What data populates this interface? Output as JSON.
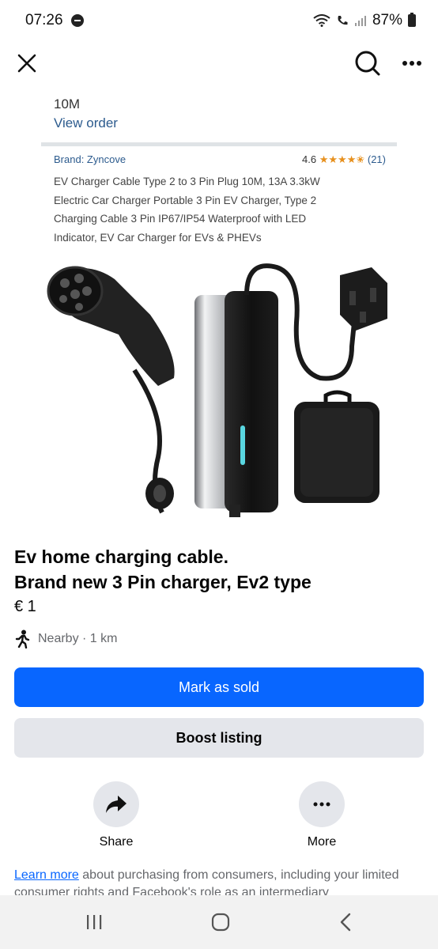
{
  "status_bar": {
    "time": "07:26",
    "battery": "87%"
  },
  "nav": {
    "close_icon": "close-icon",
    "search_icon": "search-icon",
    "more_icon": "more-icon"
  },
  "image": {
    "top_text": "10M",
    "view_order": "View order",
    "brand": "Brand: Zyncove",
    "rating": "4.6",
    "stars": "★★★★✬",
    "rating_count": "(21)",
    "description_lines": [
      "EV Charger Cable Type 2 to 3 Pin Plug 10M, 13A 3.3kW",
      "Electric Car Charger Portable 3 Pin EV Charger, Type 2",
      "Charging Cable 3 Pin IP67/IP54 Waterproof with LED",
      "Indicator, EV Car Charger for EVs & PHEVs"
    ]
  },
  "listing": {
    "title_line1": "Ev home charging cable.",
    "title_line2": "Brand new 3 Pin charger, Ev2 type",
    "price": "€ 1",
    "location": "Nearby · 1 km"
  },
  "buttons": {
    "mark_sold": "Mark as sold",
    "boost": "Boost listing"
  },
  "actions": {
    "share": "Share",
    "more": "More"
  },
  "footer": {
    "learn_more_link": "Learn more",
    "learn_more_text": " about purchasing from consumers, including your limited consumer rights and Facebook's role as an intermediary"
  },
  "colors": {
    "primary": "#0866ff",
    "secondary_bg": "#e4e6eb",
    "muted_text": "#65676b"
  }
}
